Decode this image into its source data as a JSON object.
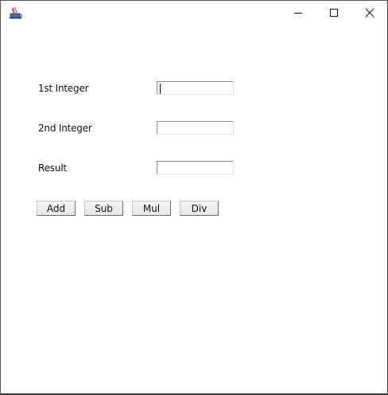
{
  "window": {
    "icon": "java-coffee-cup-icon",
    "controls": {
      "minimize_icon": "minimize-icon",
      "maximize_icon": "maximize-icon",
      "close_icon": "close-icon"
    }
  },
  "form": {
    "first_label": "1st Integer",
    "first_value": "",
    "second_label": "2nd Integer",
    "second_value": "",
    "result_label": "Result",
    "result_value": ""
  },
  "buttons": {
    "add": "Add",
    "sub": "Sub",
    "mul": "Mul",
    "div": "Div"
  }
}
